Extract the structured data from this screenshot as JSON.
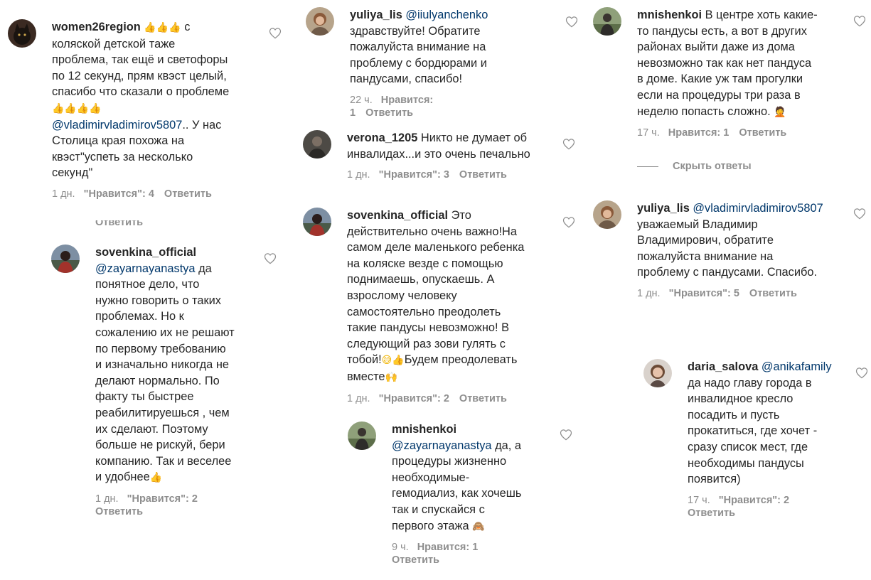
{
  "comments": [
    {
      "username": "women26region",
      "avatar": "dark-cat-icon",
      "lines": [
        [
          {
            "t": "u",
            "v": "women26region"
          },
          {
            "t": "x",
            "v": " "
          },
          {
            "t": "e",
            "v": "👍👍👍"
          },
          {
            "t": "x",
            "v": " с"
          }
        ],
        [
          {
            "t": "x",
            "v": "коляской детской таже"
          }
        ],
        [
          {
            "t": "x",
            "v": "проблема, так ещё и светофоры"
          }
        ],
        [
          {
            "t": "x",
            "v": "по 12 секунд, прям квэст целый,"
          }
        ],
        [
          {
            "t": "x",
            "v": "спасибо что сказали о проблеме"
          }
        ],
        [
          {
            "t": "e",
            "v": "👍👍👍👍"
          }
        ],
        [
          {
            "t": "m",
            "v": "@vladimirvladimirov5807"
          },
          {
            "t": "x",
            "v": ".. У нас"
          }
        ],
        [
          {
            "t": "x",
            "v": "Столица края похожа на"
          }
        ],
        [
          {
            "t": "x",
            "v": "квэст\"успеть за несколько"
          }
        ],
        [
          {
            "t": "x",
            "v": "секунд\""
          }
        ]
      ],
      "time": "1 дн.",
      "likes": "\"Нравится\": 4",
      "reply": "Ответить"
    },
    {
      "username": "sovenkina_official",
      "avatar": "silhouette-red-avatar",
      "lines": [
        [
          {
            "t": "u",
            "v": "sovenkina_official"
          }
        ],
        [
          {
            "t": "m",
            "v": "@zayarnayanastya"
          },
          {
            "t": "x",
            "v": " да"
          }
        ],
        [
          {
            "t": "x",
            "v": "понятное дело, что"
          }
        ],
        [
          {
            "t": "x",
            "v": "нужно говорить о таких"
          }
        ],
        [
          {
            "t": "x",
            "v": "проблемах. Но к"
          }
        ],
        [
          {
            "t": "x",
            "v": "сожалению их не решают"
          }
        ],
        [
          {
            "t": "x",
            "v": "по первому требованию"
          }
        ],
        [
          {
            "t": "x",
            "v": "и изначально никогда не"
          }
        ],
        [
          {
            "t": "x",
            "v": "делают нормально. По"
          }
        ],
        [
          {
            "t": "x",
            "v": "факту ты быстрее"
          }
        ],
        [
          {
            "t": "x",
            "v": "реабилитируешься , чем"
          }
        ],
        [
          {
            "t": "x",
            "v": "их сделают. Поэтому"
          }
        ],
        [
          {
            "t": "x",
            "v": "больше не рискуй, бери"
          }
        ],
        [
          {
            "t": "x",
            "v": "компанию. Так и веселее"
          }
        ],
        [
          {
            "t": "x",
            "v": "и удобнее"
          },
          {
            "t": "e",
            "v": "👍"
          }
        ]
      ],
      "time": "1 дн.",
      "likes": "\"Нравится\": 2",
      "reply": "Ответить"
    },
    {
      "username": "yuliya_lis",
      "avatar": "woman-avatar",
      "lines": [
        [
          {
            "t": "u",
            "v": "yuliya_lis"
          },
          {
            "t": "x",
            "v": " "
          },
          {
            "t": "m",
            "v": "@iiulyanchenko"
          }
        ],
        [
          {
            "t": "x",
            "v": "здравствуйте! Обратите"
          }
        ],
        [
          {
            "t": "x",
            "v": "пожалуйста внимание на"
          }
        ],
        [
          {
            "t": "x",
            "v": "проблему с бордюрами и"
          }
        ],
        [
          {
            "t": "x",
            "v": "пандусами, спасибо!"
          }
        ]
      ],
      "time": "22 ч.",
      "likes": "Нравится: 1",
      "reply": "Ответить"
    },
    {
      "username": "verona_1205",
      "avatar": "dark-avatar",
      "lines": [
        [
          {
            "t": "u",
            "v": "verona_1205"
          },
          {
            "t": "x",
            "v": " Никто не думает об"
          }
        ],
        [
          {
            "t": "x",
            "v": "инвалидах...и это очень печально"
          }
        ]
      ],
      "time": "1 дн.",
      "likes": "\"Нравится\": 3",
      "reply": "Ответить"
    },
    {
      "username": "sovenkina_official",
      "avatar": "silhouette-red-avatar",
      "lines": [
        [
          {
            "t": "u",
            "v": "sovenkina_official"
          },
          {
            "t": "x",
            "v": " Это"
          }
        ],
        [
          {
            "t": "x",
            "v": "действительно очень важно!На"
          }
        ],
        [
          {
            "t": "x",
            "v": "самом деле маленького ребенка"
          }
        ],
        [
          {
            "t": "x",
            "v": "на коляске везде с помощью"
          }
        ],
        [
          {
            "t": "x",
            "v": "поднимаешь, опускаешь. А"
          }
        ],
        [
          {
            "t": "x",
            "v": "взрослому человеку"
          }
        ],
        [
          {
            "t": "x",
            "v": "самостоятельно преодолеть"
          }
        ],
        [
          {
            "t": "x",
            "v": "такие пандусы невозможно! В"
          }
        ],
        [
          {
            "t": "x",
            "v": "следующий раз зови гулять с"
          }
        ],
        [
          {
            "t": "x",
            "v": "тобой!"
          },
          {
            "t": "e",
            "v": "😅👍"
          },
          {
            "t": "x",
            "v": "Будем преодолевать"
          }
        ],
        [
          {
            "t": "x",
            "v": "вместе"
          },
          {
            "t": "e",
            "v": "🙌"
          }
        ]
      ],
      "time": "1 дн.",
      "likes": "\"Нравится\": 2",
      "reply": "Ответить"
    },
    {
      "username": "mnishenkoi",
      "avatar": "outdoor-avatar",
      "lines": [
        [
          {
            "t": "u",
            "v": "mnishenkoi"
          }
        ],
        [
          {
            "t": "m",
            "v": "@zayarnayanastya"
          },
          {
            "t": "x",
            "v": " да, а"
          }
        ],
        [
          {
            "t": "x",
            "v": "процедуры жизненно"
          }
        ],
        [
          {
            "t": "x",
            "v": "необходимые-"
          }
        ],
        [
          {
            "t": "x",
            "v": "гемодиализ, как хочешь"
          }
        ],
        [
          {
            "t": "x",
            "v": "так и спускайся с"
          }
        ],
        [
          {
            "t": "x",
            "v": "первого этажа "
          },
          {
            "t": "f",
            "v": "🙈"
          }
        ]
      ],
      "time": "9 ч.",
      "likes": "Нравится: 1",
      "reply": "Ответить"
    },
    {
      "username": "mnishenkoi",
      "avatar": "outdoor-avatar",
      "lines": [
        [
          {
            "t": "u",
            "v": "mnishenkoi"
          },
          {
            "t": "x",
            "v": " В центре хоть какие-"
          }
        ],
        [
          {
            "t": "x",
            "v": "то пандусы есть, а вот в других"
          }
        ],
        [
          {
            "t": "x",
            "v": "районах выйти даже из дома"
          }
        ],
        [
          {
            "t": "x",
            "v": "невозможно так как нет пандуса"
          }
        ],
        [
          {
            "t": "x",
            "v": "в доме. Какие уж там прогулки"
          }
        ],
        [
          {
            "t": "x",
            "v": "если на процедуры три раза в"
          }
        ],
        [
          {
            "t": "x",
            "v": "неделю попасть сложно. "
          },
          {
            "t": "f",
            "v": "🤦"
          }
        ]
      ],
      "time": "17 ч.",
      "likes": "Нравится: 1",
      "reply": "Ответить"
    },
    {
      "username": "yuliya_lis",
      "avatar": "woman-avatar",
      "lines": [
        [
          {
            "t": "u",
            "v": "yuliya_lis"
          },
          {
            "t": "x",
            "v": " "
          },
          {
            "t": "m",
            "v": "@vladimirvladimirov5807"
          }
        ],
        [
          {
            "t": "x",
            "v": "уважаемый Владимир"
          }
        ],
        [
          {
            "t": "x",
            "v": "Владимирович, обратите"
          }
        ],
        [
          {
            "t": "x",
            "v": "пожалуйста внимание на"
          }
        ],
        [
          {
            "t": "x",
            "v": "проблему с пандусами. Спасибо."
          }
        ]
      ],
      "time": "1 дн.",
      "likes": "\"Нравится\": 5",
      "reply": "Ответить"
    },
    {
      "username": "daria_salova",
      "avatar": "portrait-avatar",
      "lines": [
        [
          {
            "t": "u",
            "v": "daria_salova"
          },
          {
            "t": "x",
            "v": " "
          },
          {
            "t": "m",
            "v": "@anikafamily"
          }
        ],
        [
          {
            "t": "x",
            "v": "да надо главу города в"
          }
        ],
        [
          {
            "t": "x",
            "v": "инвалидное кресло"
          }
        ],
        [
          {
            "t": "x",
            "v": "посадить и пусть"
          }
        ],
        [
          {
            "t": "x",
            "v": "прокатиться, где хочет -"
          }
        ],
        [
          {
            "t": "x",
            "v": "сразу список мест, где"
          }
        ],
        [
          {
            "t": "x",
            "v": "необходимы пандусы"
          }
        ],
        [
          {
            "t": "x",
            "v": "появится)"
          }
        ]
      ],
      "time": "17 ч.",
      "likes": "\"Нравится\": 2",
      "reply": "Ответить"
    }
  ],
  "hide_replies": "Скрыть ответы",
  "cutoff_reply": "Ответить",
  "colors": {
    "text": "#262626",
    "meta": "#8e8e8e",
    "mention": "#00376b",
    "heart": "#8e8e8e"
  }
}
